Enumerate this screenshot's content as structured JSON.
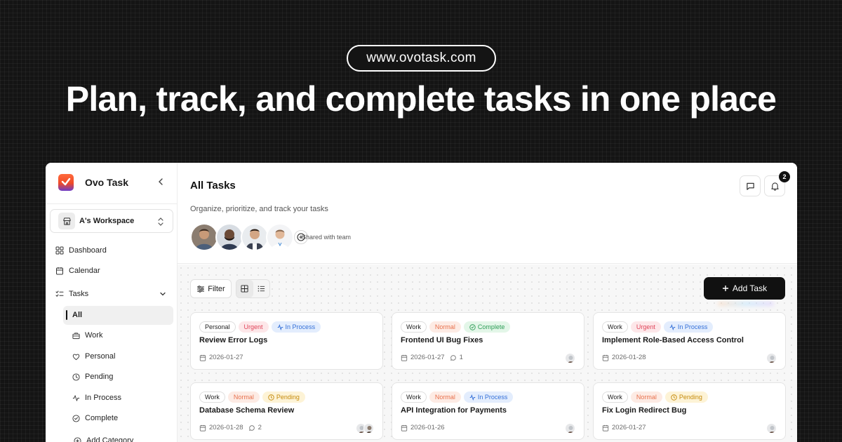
{
  "hero": {
    "url": "www.ovotask.com",
    "headline": "Plan, track, and complete tasks in one place"
  },
  "sidebar": {
    "brand": "Ovo Task",
    "workspace": "A's Workspace",
    "items": [
      {
        "label": "Dashboard",
        "icon": "grid-icon"
      },
      {
        "label": "Calendar",
        "icon": "calendar-icon"
      },
      {
        "label": "Tasks",
        "icon": "checklist-icon",
        "expanded": true
      }
    ],
    "subitems": [
      {
        "label": "All",
        "active": true
      },
      {
        "label": "Work",
        "icon": "briefcase-icon"
      },
      {
        "label": "Personal",
        "icon": "heart-icon"
      },
      {
        "label": "Pending",
        "icon": "clock-icon"
      },
      {
        "label": "In Process",
        "icon": "activity-icon"
      },
      {
        "label": "Complete",
        "icon": "check-circle-icon"
      }
    ],
    "add_category": "Add Category"
  },
  "header": {
    "title": "All Tasks",
    "subtitle": "Organize, prioritize, and track your tasks",
    "shared_label": "Shared with team",
    "notification_count": "2"
  },
  "toolbar": {
    "filter_label": "Filter",
    "add_task_label": "Add Task"
  },
  "colors": {
    "accent": "#111111",
    "urgent_bg": "#fde7e9",
    "urgent_text": "#e0455a",
    "normal_bg": "#fdebe4",
    "normal_text": "#e8704c",
    "in_process_bg": "#e3edfd",
    "in_process_text": "#3470d8",
    "complete_bg": "#e3f6e8",
    "complete_text": "#2d9d56",
    "pending_bg": "#fdf3d6",
    "pending_text": "#c58a0a"
  },
  "tasks": [
    {
      "category": "Personal",
      "priority": "Urgent",
      "status": "In Process",
      "title": "Review Error Logs",
      "date": "2026-01-27",
      "comments": "",
      "assignees": 0
    },
    {
      "category": "Work",
      "priority": "Normal",
      "status": "Complete",
      "title": "Frontend UI Bug Fixes",
      "date": "2026-01-27",
      "comments": "1",
      "assignees": 1
    },
    {
      "category": "Work",
      "priority": "Urgent",
      "status": "In Process",
      "title": "Implement Role-Based Access Control",
      "date": "2026-01-28",
      "comments": "",
      "assignees": 1
    },
    {
      "category": "Work",
      "priority": "Normal",
      "status": "Pending",
      "title": "Database Schema Review",
      "date": "2026-01-28",
      "comments": "2",
      "assignees": 2
    },
    {
      "category": "Work",
      "priority": "Normal",
      "status": "In Process",
      "title": "API Integration for Payments",
      "date": "2026-01-26",
      "comments": "",
      "assignees": 1
    },
    {
      "category": "Work",
      "priority": "Normal",
      "status": "Pending",
      "title": "Fix Login Redirect Bug",
      "date": "2026-01-27",
      "comments": "",
      "assignees": 1
    }
  ]
}
